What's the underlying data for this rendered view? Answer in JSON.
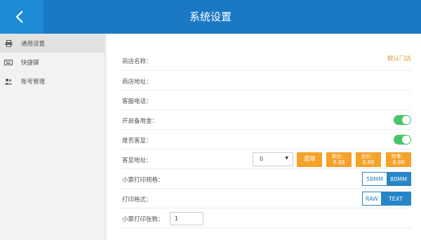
{
  "header": {
    "title": "系统设置",
    "accent": "#1b78c4"
  },
  "sidebar": {
    "items": [
      {
        "label": "通用设置",
        "icon": "printer-icon",
        "active": true
      },
      {
        "label": "快捷键",
        "icon": "keyboard-icon",
        "active": false
      },
      {
        "label": "账号管理",
        "icon": "users-icon",
        "active": false
      }
    ]
  },
  "settings": {
    "shop_name": {
      "label": "商店名称：",
      "value": "默认门店"
    },
    "shop_address": {
      "label": "商店地址："
    },
    "service_phone": {
      "label": "客服电话："
    },
    "petty_cash": {
      "label": "开启备用金：",
      "on": true
    },
    "customer_display": {
      "label": "是否客显：",
      "on": true
    },
    "display_address": {
      "label": "客显地址：",
      "selected": "0",
      "clear_label": "清除",
      "price_buttons": [
        {
          "title": "单价：",
          "value": "8.88"
        },
        {
          "title": "总价：",
          "value": "8.88"
        },
        {
          "title": "找零：",
          "value": "8.88"
        }
      ]
    },
    "receipt_spec": {
      "label": "小票打印规格：",
      "options": [
        "58MM",
        "80MM"
      ],
      "selected": "80MM"
    },
    "print_format": {
      "label": "打印格式：",
      "options": [
        "RAW",
        "TEXT"
      ],
      "selected": "TEXT"
    },
    "print_copies": {
      "label": "小票打印张数：",
      "value": "1"
    }
  },
  "colors": {
    "orange": "#f5a12a",
    "toggle_green": "#48c66a",
    "segment_blue": "#2685c6"
  }
}
